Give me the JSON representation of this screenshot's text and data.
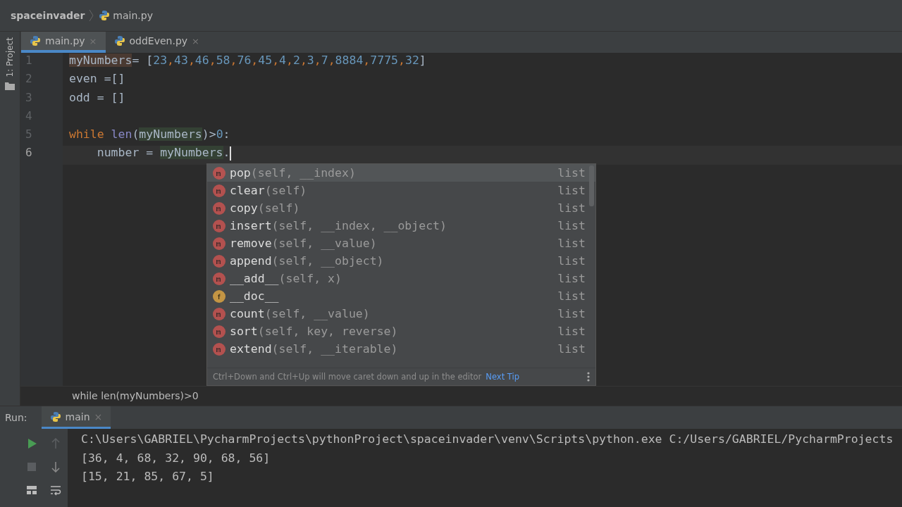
{
  "navbar": {
    "project": "spaceinvader",
    "file": "main.py"
  },
  "tool_strip": {
    "label": "1: Project"
  },
  "tabs": [
    {
      "label": "main.py",
      "close": "×",
      "selected": true
    },
    {
      "label": "oddEven.py",
      "close": "×",
      "selected": false
    }
  ],
  "editor": {
    "lines": [
      {
        "number": "1",
        "current": false,
        "tokens": [
          {
            "text": "myNumbers",
            "kind": "def"
          },
          {
            "text": "= [",
            "kind": "plain"
          },
          {
            "text": "23",
            "kind": "num"
          },
          {
            "text": ",",
            "kind": "comma"
          },
          {
            "text": "43",
            "kind": "num"
          },
          {
            "text": ",",
            "kind": "comma"
          },
          {
            "text": "46",
            "kind": "num"
          },
          {
            "text": ",",
            "kind": "comma"
          },
          {
            "text": "58",
            "kind": "num"
          },
          {
            "text": ",",
            "kind": "comma"
          },
          {
            "text": "76",
            "kind": "num"
          },
          {
            "text": ",",
            "kind": "comma"
          },
          {
            "text": "45",
            "kind": "num"
          },
          {
            "text": ",",
            "kind": "comma"
          },
          {
            "text": "4",
            "kind": "num"
          },
          {
            "text": ",",
            "kind": "comma"
          },
          {
            "text": "2",
            "kind": "num"
          },
          {
            "text": ",",
            "kind": "comma"
          },
          {
            "text": "3",
            "kind": "num"
          },
          {
            "text": ",",
            "kind": "comma"
          },
          {
            "text": "7",
            "kind": "num"
          },
          {
            "text": ",",
            "kind": "comma"
          },
          {
            "text": "8884",
            "kind": "num"
          },
          {
            "text": ",",
            "kind": "comma"
          },
          {
            "text": "7775",
            "kind": "num"
          },
          {
            "text": ",",
            "kind": "comma"
          },
          {
            "text": "32",
            "kind": "num"
          },
          {
            "text": "]",
            "kind": "plain"
          }
        ]
      },
      {
        "number": "2",
        "current": false,
        "tokens": [
          {
            "text": "even =[]",
            "kind": "plain"
          }
        ]
      },
      {
        "number": "3",
        "current": false,
        "tokens": [
          {
            "text": "odd = []",
            "kind": "plain"
          }
        ]
      },
      {
        "number": "4",
        "current": false
      },
      {
        "number": "5",
        "current": false,
        "tokens": [
          {
            "text": "while ",
            "kind": "keyword"
          },
          {
            "text": "len",
            "kind": "builtin"
          },
          {
            "text": "(",
            "kind": "plain"
          },
          {
            "text": "myNumbers",
            "kind": "ref"
          },
          {
            "text": ")>",
            "kind": "plain"
          },
          {
            "text": "0",
            "kind": "num"
          },
          {
            "text": ":",
            "kind": "plain"
          }
        ]
      },
      {
        "number": "6",
        "current": true,
        "tokens": [
          {
            "text": "    number = ",
            "kind": "plain"
          },
          {
            "text": "myNumbers",
            "kind": "ref"
          },
          {
            "text": ".",
            "kind": "plain"
          }
        ]
      }
    ],
    "breadcrumb": "while len(myNumbers)>0"
  },
  "completion": {
    "items": [
      {
        "name": "pop",
        "params": "(self, __index)",
        "type": "list",
        "kind": "method",
        "selected": true
      },
      {
        "name": "clear",
        "params": "(self)",
        "type": "list",
        "kind": "method",
        "selected": false
      },
      {
        "name": "copy",
        "params": "(self)",
        "type": "list",
        "kind": "method",
        "selected": false
      },
      {
        "name": "insert",
        "params": "(self, __index, __object)",
        "type": "list",
        "kind": "method",
        "selected": false
      },
      {
        "name": "remove",
        "params": "(self, __value)",
        "type": "list",
        "kind": "method",
        "selected": false
      },
      {
        "name": "append",
        "params": "(self, __object)",
        "type": "list",
        "kind": "method",
        "selected": false
      },
      {
        "name": "__add__",
        "params": "(self, x)",
        "type": "list",
        "kind": "method",
        "selected": false
      },
      {
        "name": "__doc__",
        "type": "list",
        "kind": "field",
        "selected": false
      },
      {
        "name": "count",
        "params": "(self, __value)",
        "type": "list",
        "kind": "method",
        "selected": false
      },
      {
        "name": "sort",
        "params": "(self, key, reverse)",
        "type": "list",
        "kind": "method",
        "selected": false
      },
      {
        "name": "extend",
        "params": "(self, __iterable)",
        "type": "list",
        "kind": "method",
        "selected": false
      }
    ],
    "hint": "Ctrl+Down and Ctrl+Up will move caret down and up in the editor",
    "tip_link": "Next Tip"
  },
  "run": {
    "label": "Run:",
    "tab": "main",
    "close": "×",
    "output": [
      "C:\\Users\\GABRIEL\\PycharmProjects\\pythonProject\\spaceinvader\\venv\\Scripts\\python.exe C:/Users/GABRIEL/PycharmProjects",
      "[36, 4, 68, 32, 90, 68, 56]",
      "[15, 21, 85, 67, 5]"
    ]
  }
}
